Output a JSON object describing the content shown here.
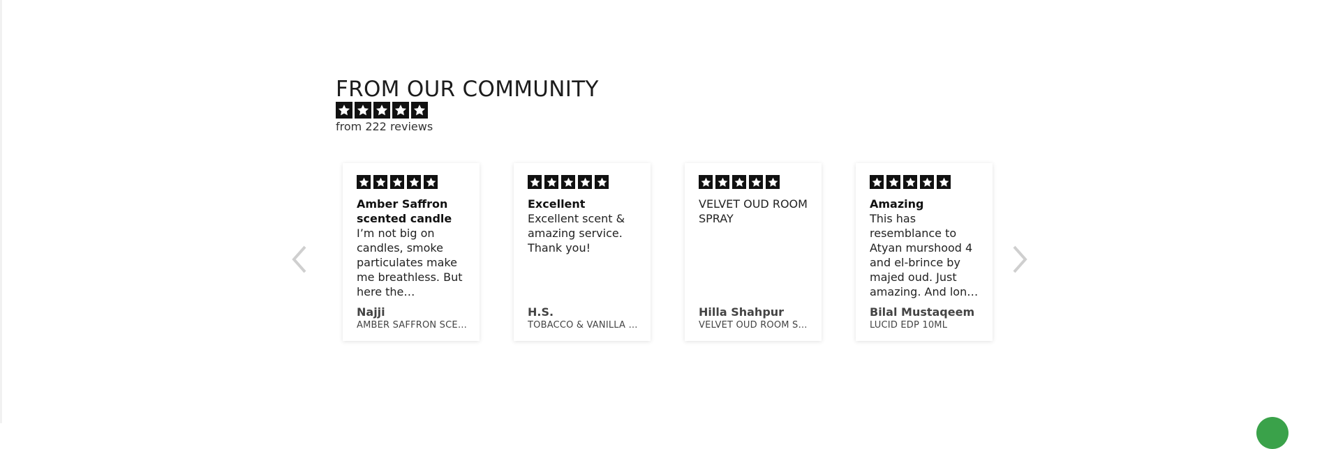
{
  "section": {
    "title": "FROM OUR COMMUNITY",
    "rating": 5,
    "review_count_text": "from 222 reviews"
  },
  "carousel": {
    "prev_icon": "chevron-left-icon",
    "next_icon": "chevron-right-icon",
    "reviews": [
      {
        "rating": 5,
        "title": "Amber Saffron scented candle",
        "text": "I’m not big on candles, smoke particulates make me breathless. But here the ingredients are clean and the scent lovely",
        "author": "Najji",
        "product": "AMBER SAFFRON SCENTED CANDLE"
      },
      {
        "rating": 5,
        "title": "Excellent",
        "text": "Excellent scent & amazing service. Thank you!",
        "author": "H.S.",
        "product": "TOBACCO & VANILLA CANDLE"
      },
      {
        "rating": 5,
        "title": "",
        "text": "VELVET OUD ROOM SPRAY",
        "author": "Hilla Shahpur",
        "product": "VELVET OUD ROOM SPRAY"
      },
      {
        "rating": 5,
        "title": "Amazing",
        "text": "This has resemblance to Atyan murshood 4 and el-brince by majed oud. Just amazing. And long lasting",
        "author": "Bilal Mustaqeem",
        "product": "LUCID EDP 10ML"
      }
    ]
  },
  "colors": {
    "star_background": "#111111",
    "star_fill": "#ffffff",
    "arrow": "#cfcfcf",
    "chat_button": "#3aa24a"
  }
}
